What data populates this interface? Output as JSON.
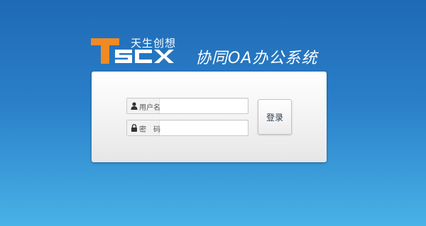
{
  "header": {
    "logo_text": "TSCX",
    "brand_cn": "天生创想",
    "system_title": "协同OA办公系统"
  },
  "login": {
    "username_label": "用户名",
    "username_value": "",
    "password_label": "密　码",
    "password_value": "",
    "submit_label": "登录"
  },
  "icons": {
    "username": "user-icon",
    "password": "lock-icon"
  },
  "colors": {
    "background_top": "#1f69b6",
    "background_bottom": "#49b2e6",
    "logo_orange": "#f08a24",
    "panel": "#f1f1f1"
  }
}
